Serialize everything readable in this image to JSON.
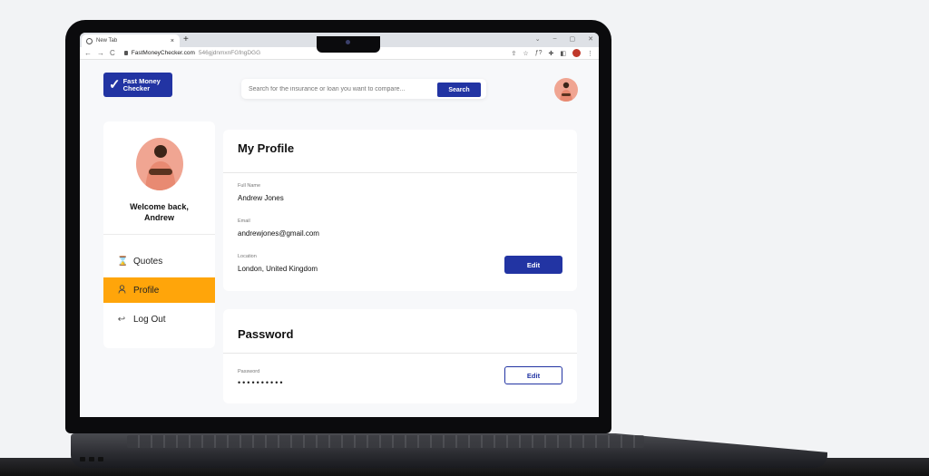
{
  "browser": {
    "tab_title": "New Tab",
    "tab_close": "×",
    "new_tab": "+",
    "url_domain": "FastMoneyChecker.com",
    "url_path": "546gjdnmxnFGfngDGG",
    "nav": {
      "back": "←",
      "forward": "→",
      "reload": "C"
    },
    "window_controls": {
      "dropdown": "⌄",
      "minimize": "–",
      "maximize": "▢",
      "close": "✕"
    },
    "toolbar_icons": {
      "share": "⇪",
      "bookmark": "☆",
      "extension_f": "ƒ?",
      "puzzle": "✚",
      "sidepanel": "◧",
      "menu": "⋮"
    }
  },
  "header": {
    "logo_line1": "Fast Money",
    "logo_line2": "Checker",
    "logo_mark": "✓",
    "search_placeholder": "Search for the insurance or loan you want to compare...",
    "search_button": "Search"
  },
  "sidebar": {
    "welcome_line1": "Welcome back,",
    "welcome_line2": "Andrew",
    "items": [
      {
        "label": "Quotes",
        "icon": "⌛",
        "active": false
      },
      {
        "label": "Profile",
        "icon": "👤",
        "active": true
      },
      {
        "label": "Log Out",
        "icon": "↩",
        "active": false
      }
    ]
  },
  "profile": {
    "title": "My Profile",
    "fields": [
      {
        "label": "Full Name",
        "value": "Andrew Jones"
      },
      {
        "label": "Email",
        "value": "andrewjones@gmail.com"
      },
      {
        "label": "Location",
        "value": "London, United Kingdom"
      }
    ],
    "edit_label": "Edit"
  },
  "password": {
    "title": "Password",
    "label": "Password",
    "value": "••••••••••",
    "edit_label": "Edit"
  },
  "colors": {
    "brand": "#2234a3",
    "active_nav": "#ffa50a",
    "avatar_bg": "#f0a592"
  }
}
